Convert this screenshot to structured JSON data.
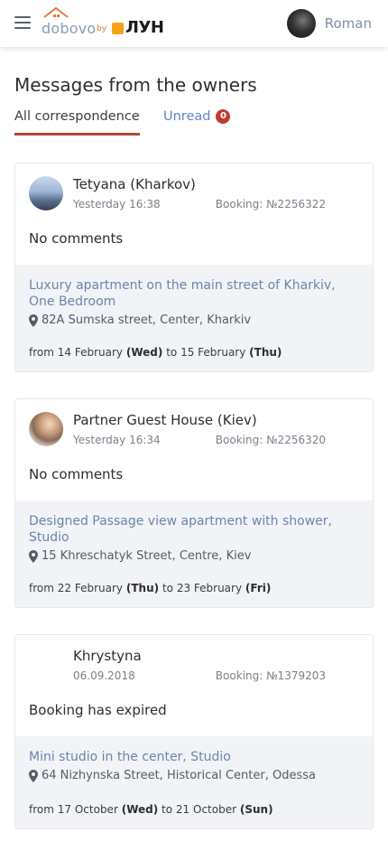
{
  "header": {
    "logo": {
      "name": "dobovo",
      "by": "by",
      "partner": "ЛУН"
    },
    "user_name": "Roman"
  },
  "page_title": "Messages from the owners",
  "tabs": [
    {
      "label": "All correspondence",
      "active": true
    },
    {
      "label": "Unread",
      "count": "0"
    }
  ],
  "booking_prefix": "Booking: ",
  "messages": [
    {
      "name": "Tetyana (Kharkov)",
      "date": "Yesterday 16:38",
      "booking": "Booking: №2256322",
      "comment": "No comments",
      "apartment": "Luxury apartment on the main street of Kharkiv, One Bedroom",
      "address": "82A Sumska street, Center, Kharkiv",
      "from_word": "from",
      "from_date": "14 February",
      "from_day": "(Wed)",
      "to_word": "to",
      "to_date": "15 February",
      "to_day": "(Thu)"
    },
    {
      "name": "Partner Guest House (Kiev)",
      "date": "Yesterday 16:34",
      "booking": "Booking: №2256320",
      "comment": "No comments",
      "apartment": "Designed Passage view apartment with shower, Studio",
      "address": "15 Khreschatyk Street, Centre, Kiev",
      "from_word": "from",
      "from_date": "22 February",
      "from_day": "(Thu)",
      "to_word": "to",
      "to_date": "23 February",
      "to_day": "(Fri)"
    },
    {
      "name": "Khrystyna",
      "date": "06.09.2018",
      "booking": "Booking: №1379203",
      "comment": "Booking has expired",
      "apartment": "Mini studio in the center, Studio",
      "address": "64 Nizhynska Street, Historical Center, Odessa",
      "from_word": "from",
      "from_date": "17 October",
      "from_day": "(Wed)",
      "to_word": "to",
      "to_date": "21 October",
      "to_day": "(Sun)"
    }
  ],
  "colors": {
    "accent_tab": "#b4473e",
    "link": "#5a86c8",
    "badge": "#bd3c34",
    "card_bottom_bg": "#f1f3f7"
  },
  "icons": [
    "hamburger-menu-icon",
    "map-pin-icon"
  ]
}
